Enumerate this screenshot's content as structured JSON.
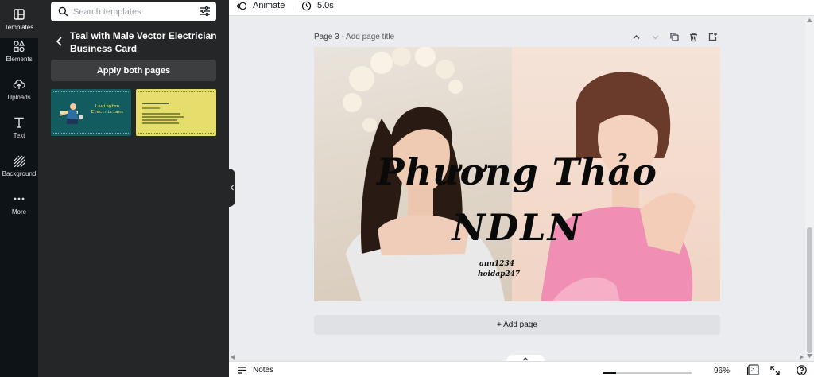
{
  "sidebar": {
    "items": [
      {
        "label": "Templates",
        "icon": "template-icon",
        "active": true
      },
      {
        "label": "Elements",
        "icon": "shapes-icon"
      },
      {
        "label": "Uploads",
        "icon": "upload-cloud-icon"
      },
      {
        "label": "Text",
        "icon": "text-icon"
      },
      {
        "label": "Background",
        "icon": "pattern-icon"
      },
      {
        "label": "More",
        "icon": "more-dots-icon"
      }
    ]
  },
  "panel": {
    "search_placeholder": "Search templates",
    "template_title": "Teal with Male Vector Electrician Business Card",
    "apply_button": "Apply both pages",
    "thumbnails": [
      {
        "text": "Lovington Electricians",
        "color": "#125c60"
      },
      {
        "color": "#e6de6a"
      }
    ]
  },
  "toolbar": {
    "animate_label": "Animate",
    "duration_label": "5.0s"
  },
  "canvas": {
    "page_number": "Page 3",
    "page_title_placeholder": "Add page title",
    "design": {
      "title_line1": "Phương Thảo",
      "title_line2": "NDLN",
      "credit_line1": "ann1234",
      "credit_line2": "hoidap247"
    },
    "add_page_label": "+ Add page"
  },
  "bottombar": {
    "notes_label": "Notes",
    "zoom_level": "96%",
    "zoom_fraction": 0.15,
    "page_count": "3"
  },
  "colors": {
    "rail_bg": "#0e1318",
    "panel_bg": "#252627",
    "canvas_bg": "#ebecf0"
  }
}
